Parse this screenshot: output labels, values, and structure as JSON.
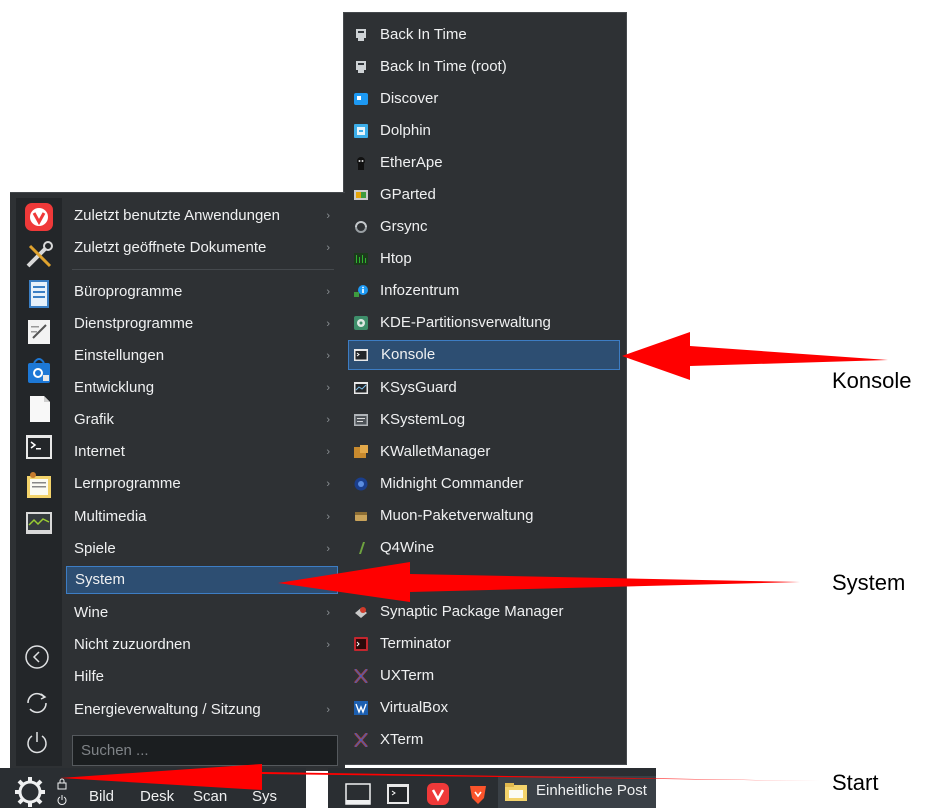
{
  "main_menu": {
    "items": [
      {
        "label": "Zuletzt benutzte Anwendungen",
        "arrow": "›"
      },
      {
        "label": "Zuletzt geöffnete Dokumente",
        "arrow": "›"
      },
      {
        "label": "Büroprogramme",
        "arrow": "›"
      },
      {
        "label": "Dienstprogramme",
        "arrow": "›"
      },
      {
        "label": "Einstellungen",
        "arrow": "›"
      },
      {
        "label": "Entwicklung",
        "arrow": "›"
      },
      {
        "label": "Grafik",
        "arrow": "›"
      },
      {
        "label": "Internet",
        "arrow": "›"
      },
      {
        "label": "Lernprogramme",
        "arrow": "›"
      },
      {
        "label": "Multimedia",
        "arrow": "›"
      },
      {
        "label": "Spiele",
        "arrow": "›"
      },
      {
        "label": "System",
        "arrow": ""
      },
      {
        "label": "Wine",
        "arrow": "›"
      },
      {
        "label": "Nicht zuzuordnen",
        "arrow": "›"
      },
      {
        "label": "Hilfe",
        "arrow": ""
      },
      {
        "label": "Energieverwaltung / Sitzung",
        "arrow": "›"
      }
    ],
    "search_placeholder": "Suchen ..."
  },
  "favorites": [
    "vivaldi-icon",
    "settings-tools-icon",
    "document-editor-icon",
    "text-editor-icon",
    "store-icon",
    "blank-document-icon",
    "terminal-icon",
    "notes-icon",
    "system-monitor-icon"
  ],
  "nav_buttons": [
    "back-icon",
    "refresh-icon",
    "power-icon"
  ],
  "sub_menu": {
    "items": [
      {
        "label": "Back In Time",
        "icon": "backintime-icon"
      },
      {
        "label": "Back In Time (root)",
        "icon": "backintime-root-icon"
      },
      {
        "label": "Discover",
        "icon": "discover-icon"
      },
      {
        "label": "Dolphin",
        "icon": "dolphin-icon"
      },
      {
        "label": "EtherApe",
        "icon": "etherape-icon"
      },
      {
        "label": "GParted",
        "icon": "gparted-icon"
      },
      {
        "label": "Grsync",
        "icon": "grsync-icon"
      },
      {
        "label": "Htop",
        "icon": "htop-icon"
      },
      {
        "label": "Infozentrum",
        "icon": "infozentrum-icon"
      },
      {
        "label": "KDE-Partitionsverwaltung",
        "icon": "partition-manager-icon"
      },
      {
        "label": "Konsole",
        "icon": "konsole-icon"
      },
      {
        "label": "KSysGuard",
        "icon": "ksysguard-icon"
      },
      {
        "label": "KSystemLog",
        "icon": "ksystemlog-icon"
      },
      {
        "label": "KWalletManager",
        "icon": "kwallet-icon"
      },
      {
        "label": "Midnight Commander",
        "icon": "midnight-commander-icon"
      },
      {
        "label": "Muon-Paketverwaltung",
        "icon": "muon-icon"
      },
      {
        "label": "Q4Wine",
        "icon": "q4wine-icon"
      },
      {
        "label": "Synaptic Package Manager",
        "icon": "synaptic-icon"
      },
      {
        "label": "Terminator",
        "icon": "terminator-icon"
      },
      {
        "label": "UXTerm",
        "icon": "uxterm-icon"
      },
      {
        "label": "VirtualBox",
        "icon": "virtualbox-icon"
      },
      {
        "label": "XTerm",
        "icon": "xterm-icon"
      }
    ]
  },
  "taskbar": {
    "items": [
      "Bild",
      "Desk",
      "Scan",
      "Sys"
    ],
    "window_title": "Einheitliche Post"
  },
  "annotations": {
    "konsole": "Konsole",
    "system": "System",
    "start": "Start"
  },
  "colors": {
    "menu_bg": "#2e3134",
    "highlight": "#2d4e72",
    "highlight_border": "#3d7dc4",
    "arrow": "#ff0000"
  }
}
